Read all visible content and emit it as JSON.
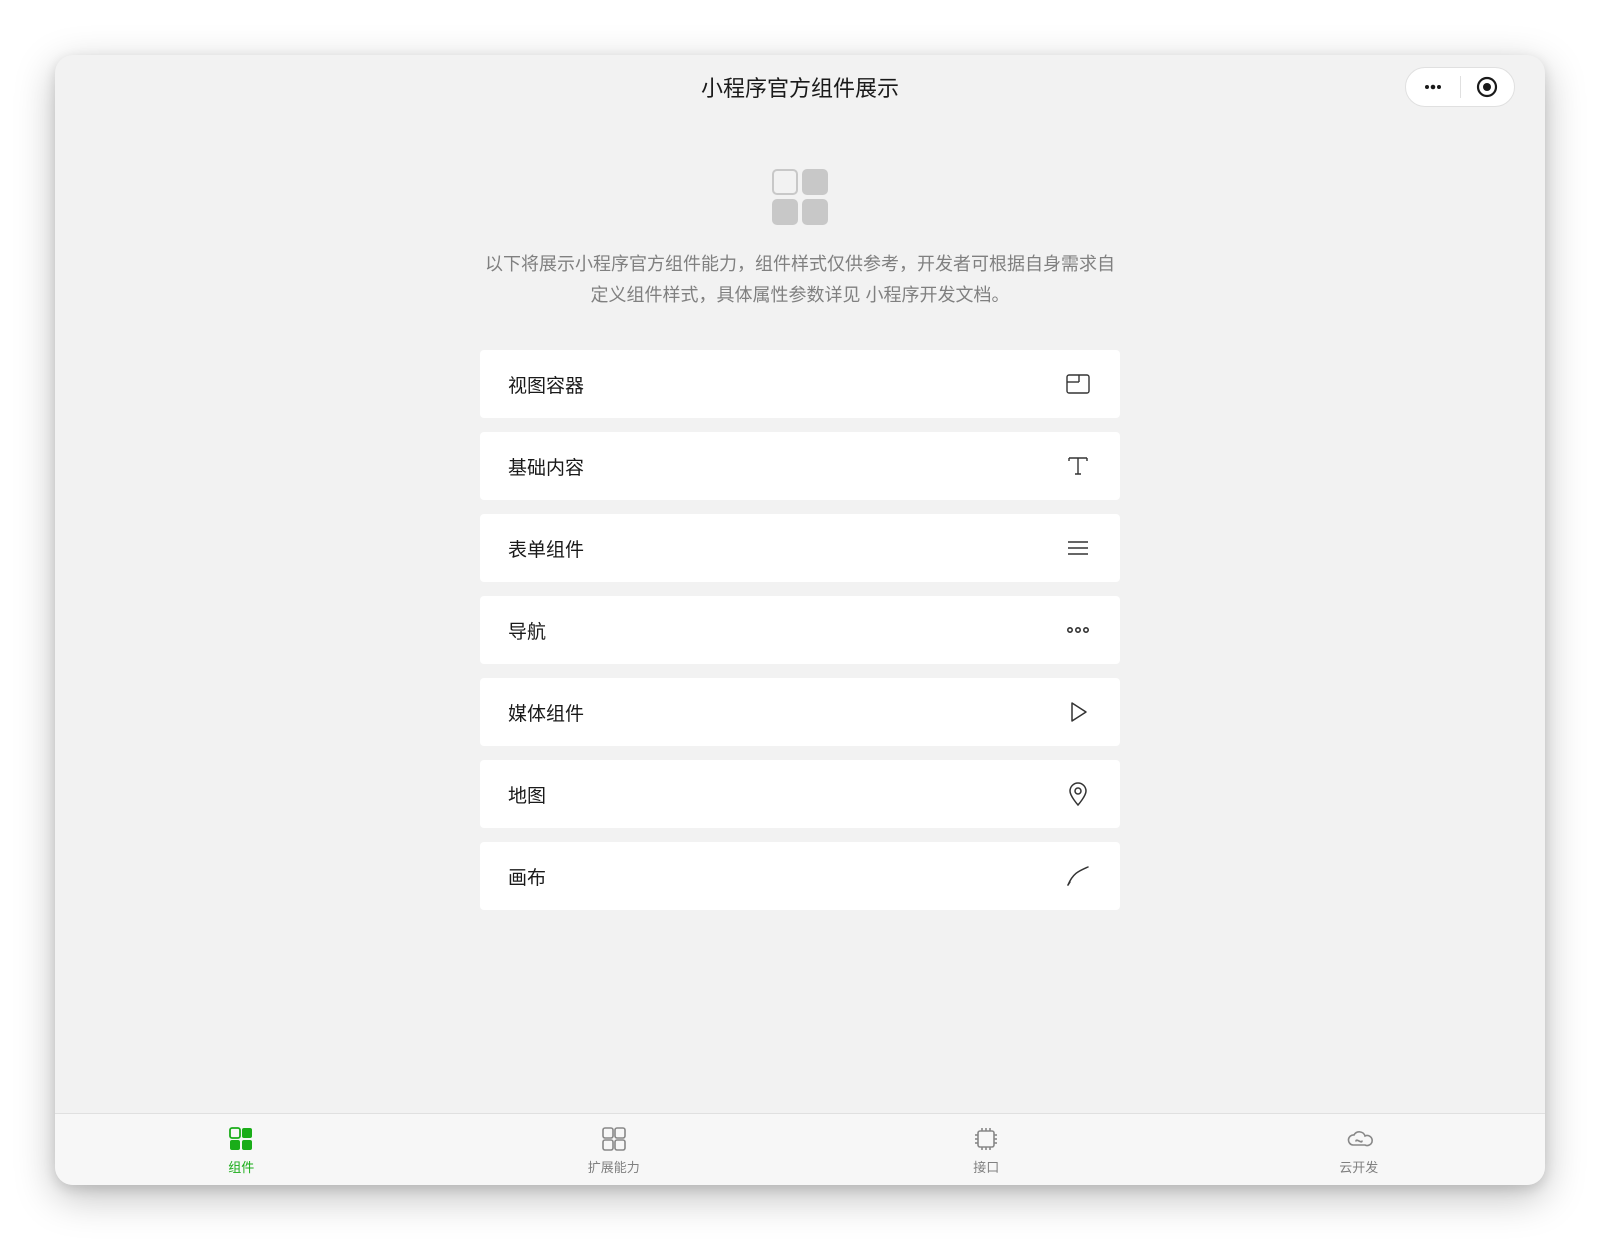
{
  "header": {
    "title": "小程序官方组件展示"
  },
  "description": {
    "text_part1": "以下将展示小程序官方组件能力，组件样式仅供参考，开发者可根据自身需求自定义组件样式，具体属性参数详见 ",
    "link_text": "小程序开发文档",
    "text_part2": "。"
  },
  "list": [
    {
      "label": "视图容器",
      "icon": "container"
    },
    {
      "label": "基础内容",
      "icon": "text"
    },
    {
      "label": "表单组件",
      "icon": "form"
    },
    {
      "label": "导航",
      "icon": "nav"
    },
    {
      "label": "媒体组件",
      "icon": "media"
    },
    {
      "label": "地图",
      "icon": "map"
    },
    {
      "label": "画布",
      "icon": "canvas"
    }
  ],
  "tabbar": [
    {
      "label": "组件",
      "icon": "component",
      "active": true
    },
    {
      "label": "扩展能力",
      "icon": "extension",
      "active": false
    },
    {
      "label": "接口",
      "icon": "api",
      "active": false
    },
    {
      "label": "云开发",
      "icon": "cloud",
      "active": false
    }
  ]
}
